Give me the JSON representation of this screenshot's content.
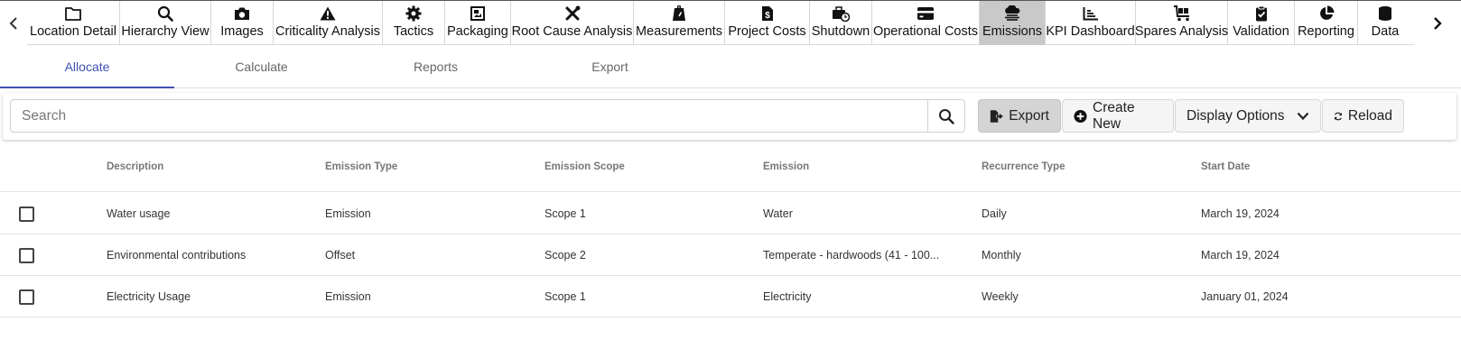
{
  "toolbar_modules": [
    {
      "label": "Location Detail",
      "icon": "folder-icon"
    },
    {
      "label": "Hierarchy View",
      "icon": "search-icon"
    },
    {
      "label": "Images",
      "icon": "camera-icon"
    },
    {
      "label": "Criticality Analysis",
      "icon": "warning-icon"
    },
    {
      "label": "Tactics",
      "icon": "gear-icon"
    },
    {
      "label": "Packaging",
      "icon": "package-icon"
    },
    {
      "label": "Root Cause Analysis",
      "icon": "tools-icon"
    },
    {
      "label": "Measurements",
      "icon": "gauge-icon"
    },
    {
      "label": "Project Costs",
      "icon": "money-file-icon"
    },
    {
      "label": "Shutdown",
      "icon": "briefcase-clock-icon"
    },
    {
      "label": "Operational Costs",
      "icon": "credit-card-icon"
    },
    {
      "label": "Emissions",
      "icon": "cloud-rain-icon"
    },
    {
      "label": "KPI Dashboard",
      "icon": "line-chart-icon"
    },
    {
      "label": "Spares Analysis",
      "icon": "cart-icon"
    },
    {
      "label": "Validation",
      "icon": "clipboard-check-icon"
    },
    {
      "label": "Reporting",
      "icon": "pie-chart-icon"
    },
    {
      "label": "Data",
      "icon": "database-icon"
    }
  ],
  "active_module": "Emissions",
  "tabs": [
    "Allocate",
    "Calculate",
    "Reports",
    "Export"
  ],
  "active_tab": "Allocate",
  "search": {
    "placeholder": "Search",
    "value": ""
  },
  "actions": {
    "export_label": "Export",
    "create_label": "Create New",
    "display_label": "Display Options",
    "reload_label": "Reload"
  },
  "table": {
    "headers": [
      "Description",
      "Emission Type",
      "Emission Scope",
      "Emission",
      "Recurrence Type",
      "Start Date"
    ],
    "rows": [
      [
        "Water usage",
        "Emission",
        "Scope 1",
        "Water",
        "Daily",
        "March 19, 2024"
      ],
      [
        "Environmental contributions",
        "Offset",
        "Scope 2",
        "Temperate - hardwoods (41 - 100...",
        "Monthly",
        "March 19, 2024"
      ],
      [
        "Electricity Usage",
        "Emission",
        "Scope 1",
        "Electricity",
        "Weekly",
        "January 01, 2024"
      ]
    ]
  },
  "colors": {
    "accent": "#3f51b5",
    "active_module_bg": "#c9c9c9"
  }
}
